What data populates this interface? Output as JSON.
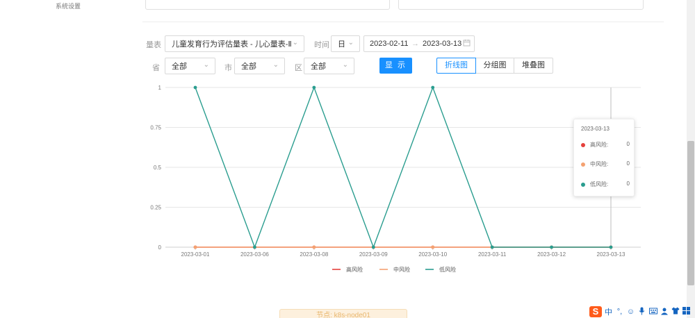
{
  "sidebar": {
    "items": [
      {
        "label": "系统设置"
      }
    ]
  },
  "filters": {
    "scale_label": "量表",
    "scale_value": "儿童发育行为评估量表 - 儿心量表-Ⅱ",
    "time_label": "时间",
    "time_unit": "日",
    "date_start": "2023-02-11",
    "date_arrow": "→",
    "date_end": "2023-03-13",
    "province_label": "省",
    "province_value": "全部",
    "city_label": "市",
    "city_value": "全部",
    "district_label": "区",
    "district_value": "全部",
    "show_button": "显 示",
    "view_tabs": [
      "折线图",
      "分组图",
      "堆叠图"
    ],
    "active_tab": "折线图"
  },
  "chart_data": {
    "type": "line",
    "x": [
      "2023-03-01",
      "2023-03-06",
      "2023-03-08",
      "2023-03-09",
      "2023-03-10",
      "2023-03-11",
      "2023-03-12",
      "2023-03-13"
    ],
    "yticks": [
      "0",
      "0.25",
      "0.5",
      "0.75",
      "1"
    ],
    "ylim": [
      0,
      1
    ],
    "grid": true,
    "legend_position": "bottom",
    "series": [
      {
        "name": "高风险",
        "color": "#e5413c",
        "values": [
          0,
          0,
          0,
          0,
          0,
          0,
          0,
          0
        ]
      },
      {
        "name": "中风险",
        "color": "#f4a271",
        "values": [
          0,
          0,
          0,
          0,
          0,
          0,
          0,
          0
        ]
      },
      {
        "name": "低风险",
        "color": "#2a9d8f",
        "values": [
          1,
          0,
          1,
          0,
          1,
          0,
          0,
          0
        ]
      }
    ]
  },
  "tooltip": {
    "title": "2023-03-13",
    "rows": [
      {
        "name": "高风险:",
        "value": "0",
        "color": "#e5413c"
      },
      {
        "name": "中风险:",
        "value": "0",
        "color": "#f4a271"
      },
      {
        "name": "低风险:",
        "value": "0",
        "color": "#2a9d8f"
      }
    ]
  },
  "toast": {
    "text": "节点: k8s-node01"
  },
  "ime": {
    "logo": "S",
    "mode": "中",
    "punct": "°,"
  }
}
